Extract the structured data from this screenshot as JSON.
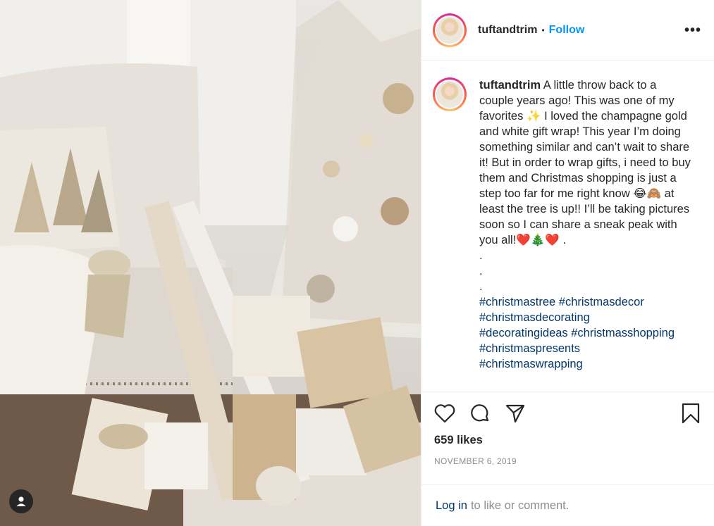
{
  "post": {
    "username": "tuftandtrim",
    "follow_label": "Follow",
    "more_label": "•••",
    "caption": {
      "username": "tuftandtrim",
      "text": "A little throw back to a couple years ago! This was one of my favorites ✨ I loved the champagne gold and white gift wrap! This year I’m doing something similar and can’t wait to share it! But in order to wrap gifts, i need to buy them and Christmas shopping is just a step too far for me right know 😂🙈 at least the tree is up!! I’ll be taking pictures soon so I can share a sneak peak with you all!❤️🎄❤️ .",
      "dots": [
        ".",
        ".",
        "."
      ],
      "hashtags": [
        "#christmastree #christmasdecor",
        "#christmasdecorating",
        "#decoratingideas #christmasshopping",
        "#christmaspresents",
        "#christmaswrapping"
      ]
    },
    "likes": "659 likes",
    "date": "NOVEMBER 6, 2019",
    "login": {
      "link": "Log in",
      "text": "to like or comment."
    }
  },
  "icons": {
    "like": "heart-icon",
    "comment": "comment-bubble-icon",
    "share": "paper-plane-icon",
    "save": "bookmark-icon",
    "user_tag": "user-tag-icon"
  }
}
